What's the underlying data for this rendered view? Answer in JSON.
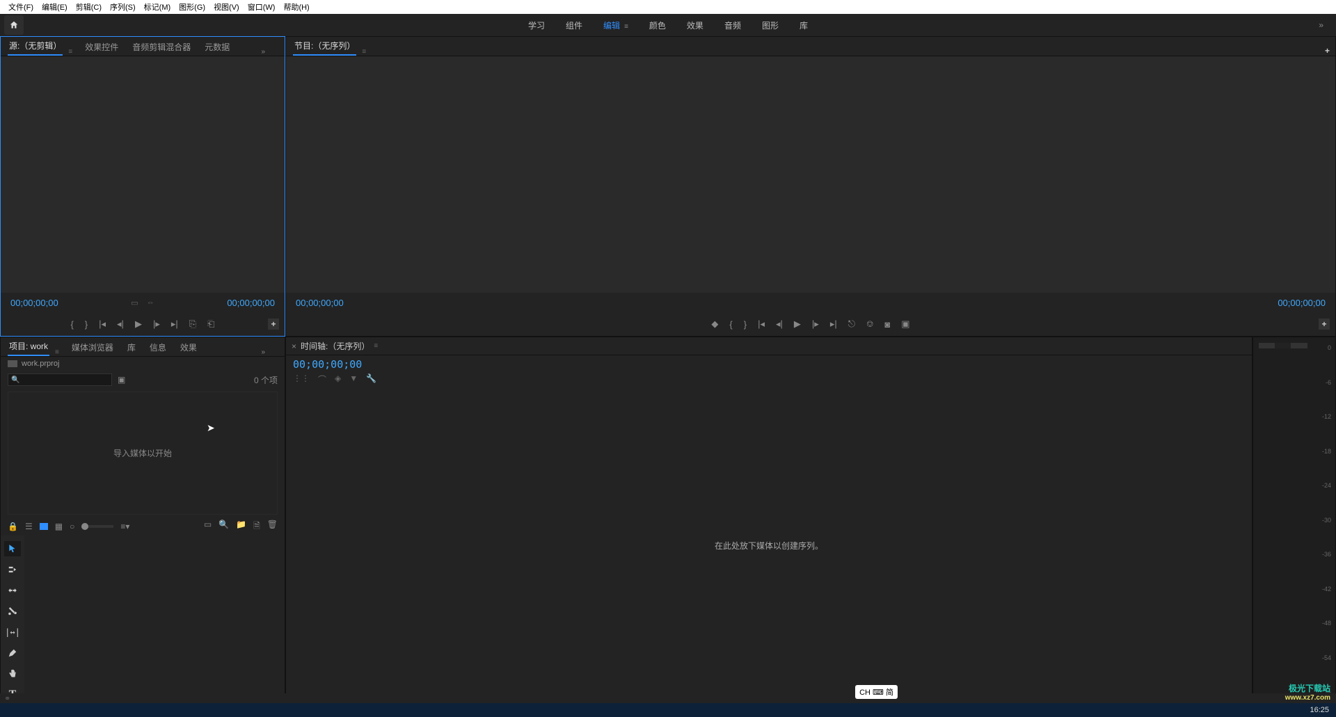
{
  "menu": {
    "items": [
      "文件(F)",
      "编辑(E)",
      "剪辑(C)",
      "序列(S)",
      "标记(M)",
      "图形(G)",
      "视图(V)",
      "窗口(W)",
      "帮助(H)"
    ]
  },
  "workspace": {
    "tabs": [
      "学习",
      "组件",
      "编辑",
      "颜色",
      "效果",
      "音频",
      "图形",
      "库"
    ],
    "active_index": 2
  },
  "source_panel": {
    "tabs": [
      "源:（无剪辑）",
      "效果控件",
      "音频剪辑混合器",
      "元数据"
    ],
    "active_index": 0,
    "tc_left": "00;00;00;00",
    "tc_right": "00;00;00;00"
  },
  "program_panel": {
    "tab": "节目:（无序列）",
    "tc_left": "00;00;00;00",
    "tc_right": "00;00;00;00"
  },
  "project_panel": {
    "tabs": [
      "项目: work",
      "媒体浏览器",
      "库",
      "信息",
      "效果"
    ],
    "active_index": 0,
    "filename": "work.prproj",
    "item_count": "0 个项",
    "empty_hint": "导入媒体以开始"
  },
  "timeline_panel": {
    "tab": "时间轴:（无序列）",
    "tc": "00;00;00;00",
    "empty_hint": "在此处放下媒体以创建序列。"
  },
  "audio_meter": {
    "ticks": [
      "0",
      "-6",
      "-12",
      "-18",
      "-24",
      "-30",
      "-36",
      "-42",
      "-48",
      "-54",
      "--"
    ]
  },
  "tools": {
    "items": [
      "selection",
      "track-select",
      "ripple-edit",
      "razor",
      "slip",
      "pen",
      "hand",
      "type"
    ],
    "active_index": 0
  },
  "ime": {
    "label": "CH ⌨ 简"
  },
  "watermark": {
    "line1": "极光下载站",
    "line2": "www.xz7.com"
  },
  "taskbar": {
    "clock": "16:25"
  }
}
